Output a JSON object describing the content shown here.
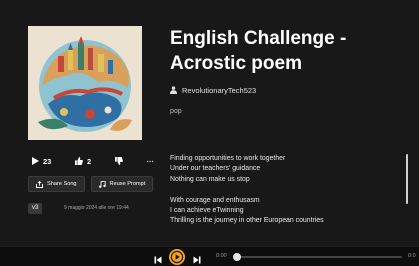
{
  "song": {
    "title_line1": "English Challenge -",
    "title_line2": "Acrostic poem",
    "author": "RevolutionaryTech523",
    "genre": "pop",
    "version": "v3",
    "date": "9 maggio 2024 alle ore 19:44"
  },
  "stats": {
    "plays": "23",
    "likes": "2",
    "more_label": "···"
  },
  "actions": {
    "share_label": "Share Song",
    "reuse_label": "Reuse Prompt"
  },
  "lyrics": {
    "stanza1": [
      "Finding opportunities to work together",
      "Under our teachers' guidance",
      "Nothing can make us stop"
    ],
    "stanza2": [
      "With courage and  enthusasm",
      "I can achieve eTwinning",
      "Thrilling is the journey in other European countries"
    ]
  },
  "player": {
    "current_time": "0:00",
    "end_time": "0:0",
    "progress": 0
  },
  "colors": {
    "background": "#181818",
    "accent_play": "#f6a623",
    "player_bar": "#0d0d0d",
    "button": "#2a2a2a"
  },
  "icons": {
    "plays": "play-icon",
    "likes": "thumbs-up-icon",
    "dislike": "thumbs-down-icon",
    "author": "person-icon",
    "share": "share-icon",
    "reuse": "music-note-icon",
    "prev": "skip-previous-icon",
    "play": "play-icon",
    "next": "skip-next-icon"
  }
}
